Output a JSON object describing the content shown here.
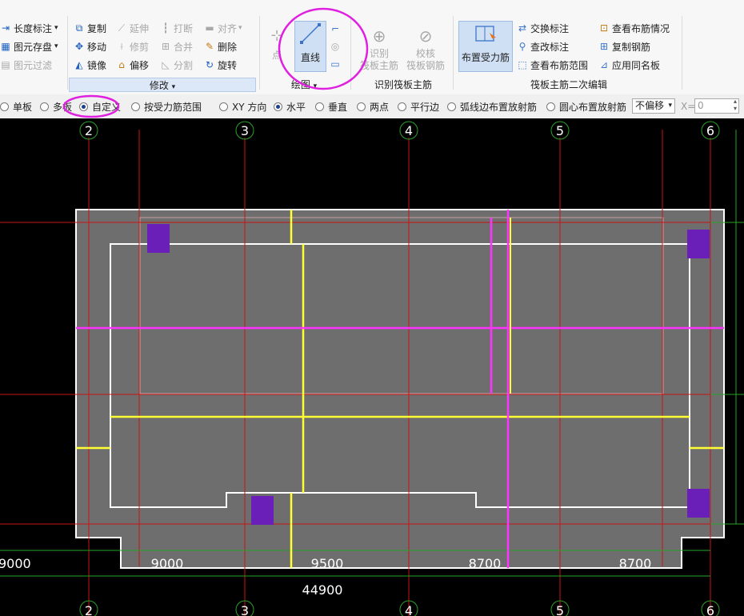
{
  "ribbon": {
    "left_partial": {
      "length_label": "长度标注",
      "save_label": "图元存盘",
      "filter_label": "图元过滤"
    },
    "modify": {
      "copy": "复制",
      "extend": "延伸",
      "break": "打断",
      "align": "对齐",
      "move": "移动",
      "trim": "修剪",
      "merge": "合并",
      "delete": "删除",
      "mirror": "镜像",
      "offset": "偏移",
      "split": "分割",
      "rotate": "旋转",
      "group_label": "修改"
    },
    "draw": {
      "point": "点",
      "line": "直线",
      "group_label": "绘图"
    },
    "identify": {
      "identify_btn": "识别\n筏板主筋",
      "check_btn": "校核\n筏板钢筋",
      "group_label": "识别筏板主筋"
    },
    "secondary": {
      "place_btn": "布置受力筋",
      "swap_label": "交换标注",
      "check_modify_label": "查改标注",
      "view_range_label": "查看布筋范围",
      "view_layout_label": "查看布筋情况",
      "copy_rebar_label": "复制钢筋",
      "apply_same_label": "应用同名板",
      "group_label": "筏板主筋二次编辑"
    }
  },
  "options": {
    "single": "单板",
    "multi": "多板",
    "custom": "自定义",
    "by_range": "按受力筋范围",
    "xy": "XY 方向",
    "horizontal": "水平",
    "vertical": "垂直",
    "two_point": "两点",
    "parallel": "平行边",
    "arc_radial": "弧线边布置放射筋",
    "center_radial": "圆心布置放射筋",
    "offset_select": "不偏移",
    "x_label": "X=",
    "x_value": "0"
  },
  "canvas": {
    "axis_top": [
      "2",
      "3",
      "4",
      "5",
      "6"
    ],
    "axis_bottom": [
      "2",
      "3",
      "4",
      "5",
      "6"
    ],
    "dims": [
      "9000",
      "9000",
      "9500",
      "8700",
      "8700"
    ],
    "total_dim": "44900"
  },
  "colors": {
    "axis_red": "#c81414",
    "rebar_yellow": "#ffff33",
    "rebar_magenta": "#ff33ff",
    "slab_gray": "#6e6e6e",
    "column_purple": "#6a1fb8",
    "dim_green": "#2aa02a",
    "highlight": "#e020e0"
  }
}
